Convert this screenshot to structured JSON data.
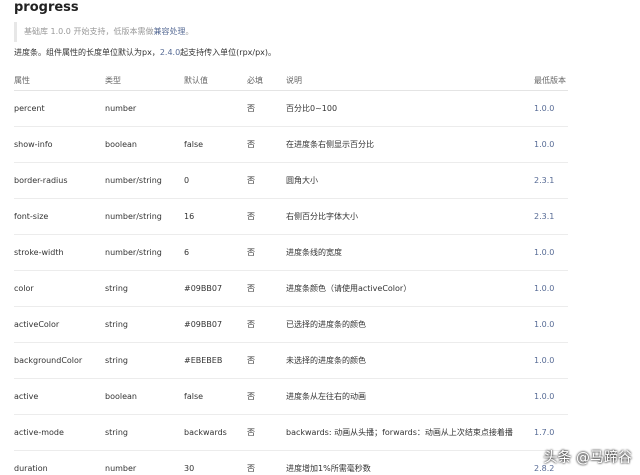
{
  "title": "progress",
  "tip": {
    "text": "基础库 1.0.0 开始支持，低版本需做",
    "link": "兼容处理",
    "end": "。"
  },
  "desc": {
    "before": "进度条。组件属性的长度单位默认为px，",
    "link": "2.4.0",
    "after": "起支持传入单位(rpx/px)。"
  },
  "table": {
    "headers": [
      "属性",
      "类型",
      "默认值",
      "必填",
      "说明",
      "最低版本"
    ],
    "rows": [
      [
        "percent",
        "number",
        "",
        "否",
        "百分比0~100",
        "1.0.0"
      ],
      [
        "show-info",
        "boolean",
        "false",
        "否",
        "在进度条右侧显示百分比",
        "1.0.0"
      ],
      [
        "border-radius",
        "number/string",
        "0",
        "否",
        "圆角大小",
        "2.3.1"
      ],
      [
        "font-size",
        "number/string",
        "16",
        "否",
        "右侧百分比字体大小",
        "2.3.1"
      ],
      [
        "stroke-width",
        "number/string",
        "6",
        "否",
        "进度条线的宽度",
        "1.0.0"
      ],
      [
        "color",
        "string",
        "#09BB07",
        "否",
        "进度条颜色（请使用activeColor）",
        "1.0.0"
      ],
      [
        "activeColor",
        "string",
        "#09BB07",
        "否",
        "已选择的进度条的颜色",
        "1.0.0"
      ],
      [
        "backgroundColor",
        "string",
        "#EBEBEB",
        "否",
        "未选择的进度条的颜色",
        "1.0.0"
      ],
      [
        "active",
        "boolean",
        "false",
        "否",
        "进度条从左往右的动画",
        "1.0.0"
      ],
      [
        "active-mode",
        "string",
        "backwards",
        "否",
        "backwards: 动画从头播；forwards：动画从上次结束点接着播",
        "1.7.0"
      ],
      [
        "duration",
        "number",
        "30",
        "否",
        "进度增加1%所需毫秒数",
        "2.8.2"
      ]
    ]
  },
  "watermark": "头条 @马蹄谷",
  "colors": {
    "link": "#576b95",
    "text": "#333333",
    "muted": "#999999"
  }
}
